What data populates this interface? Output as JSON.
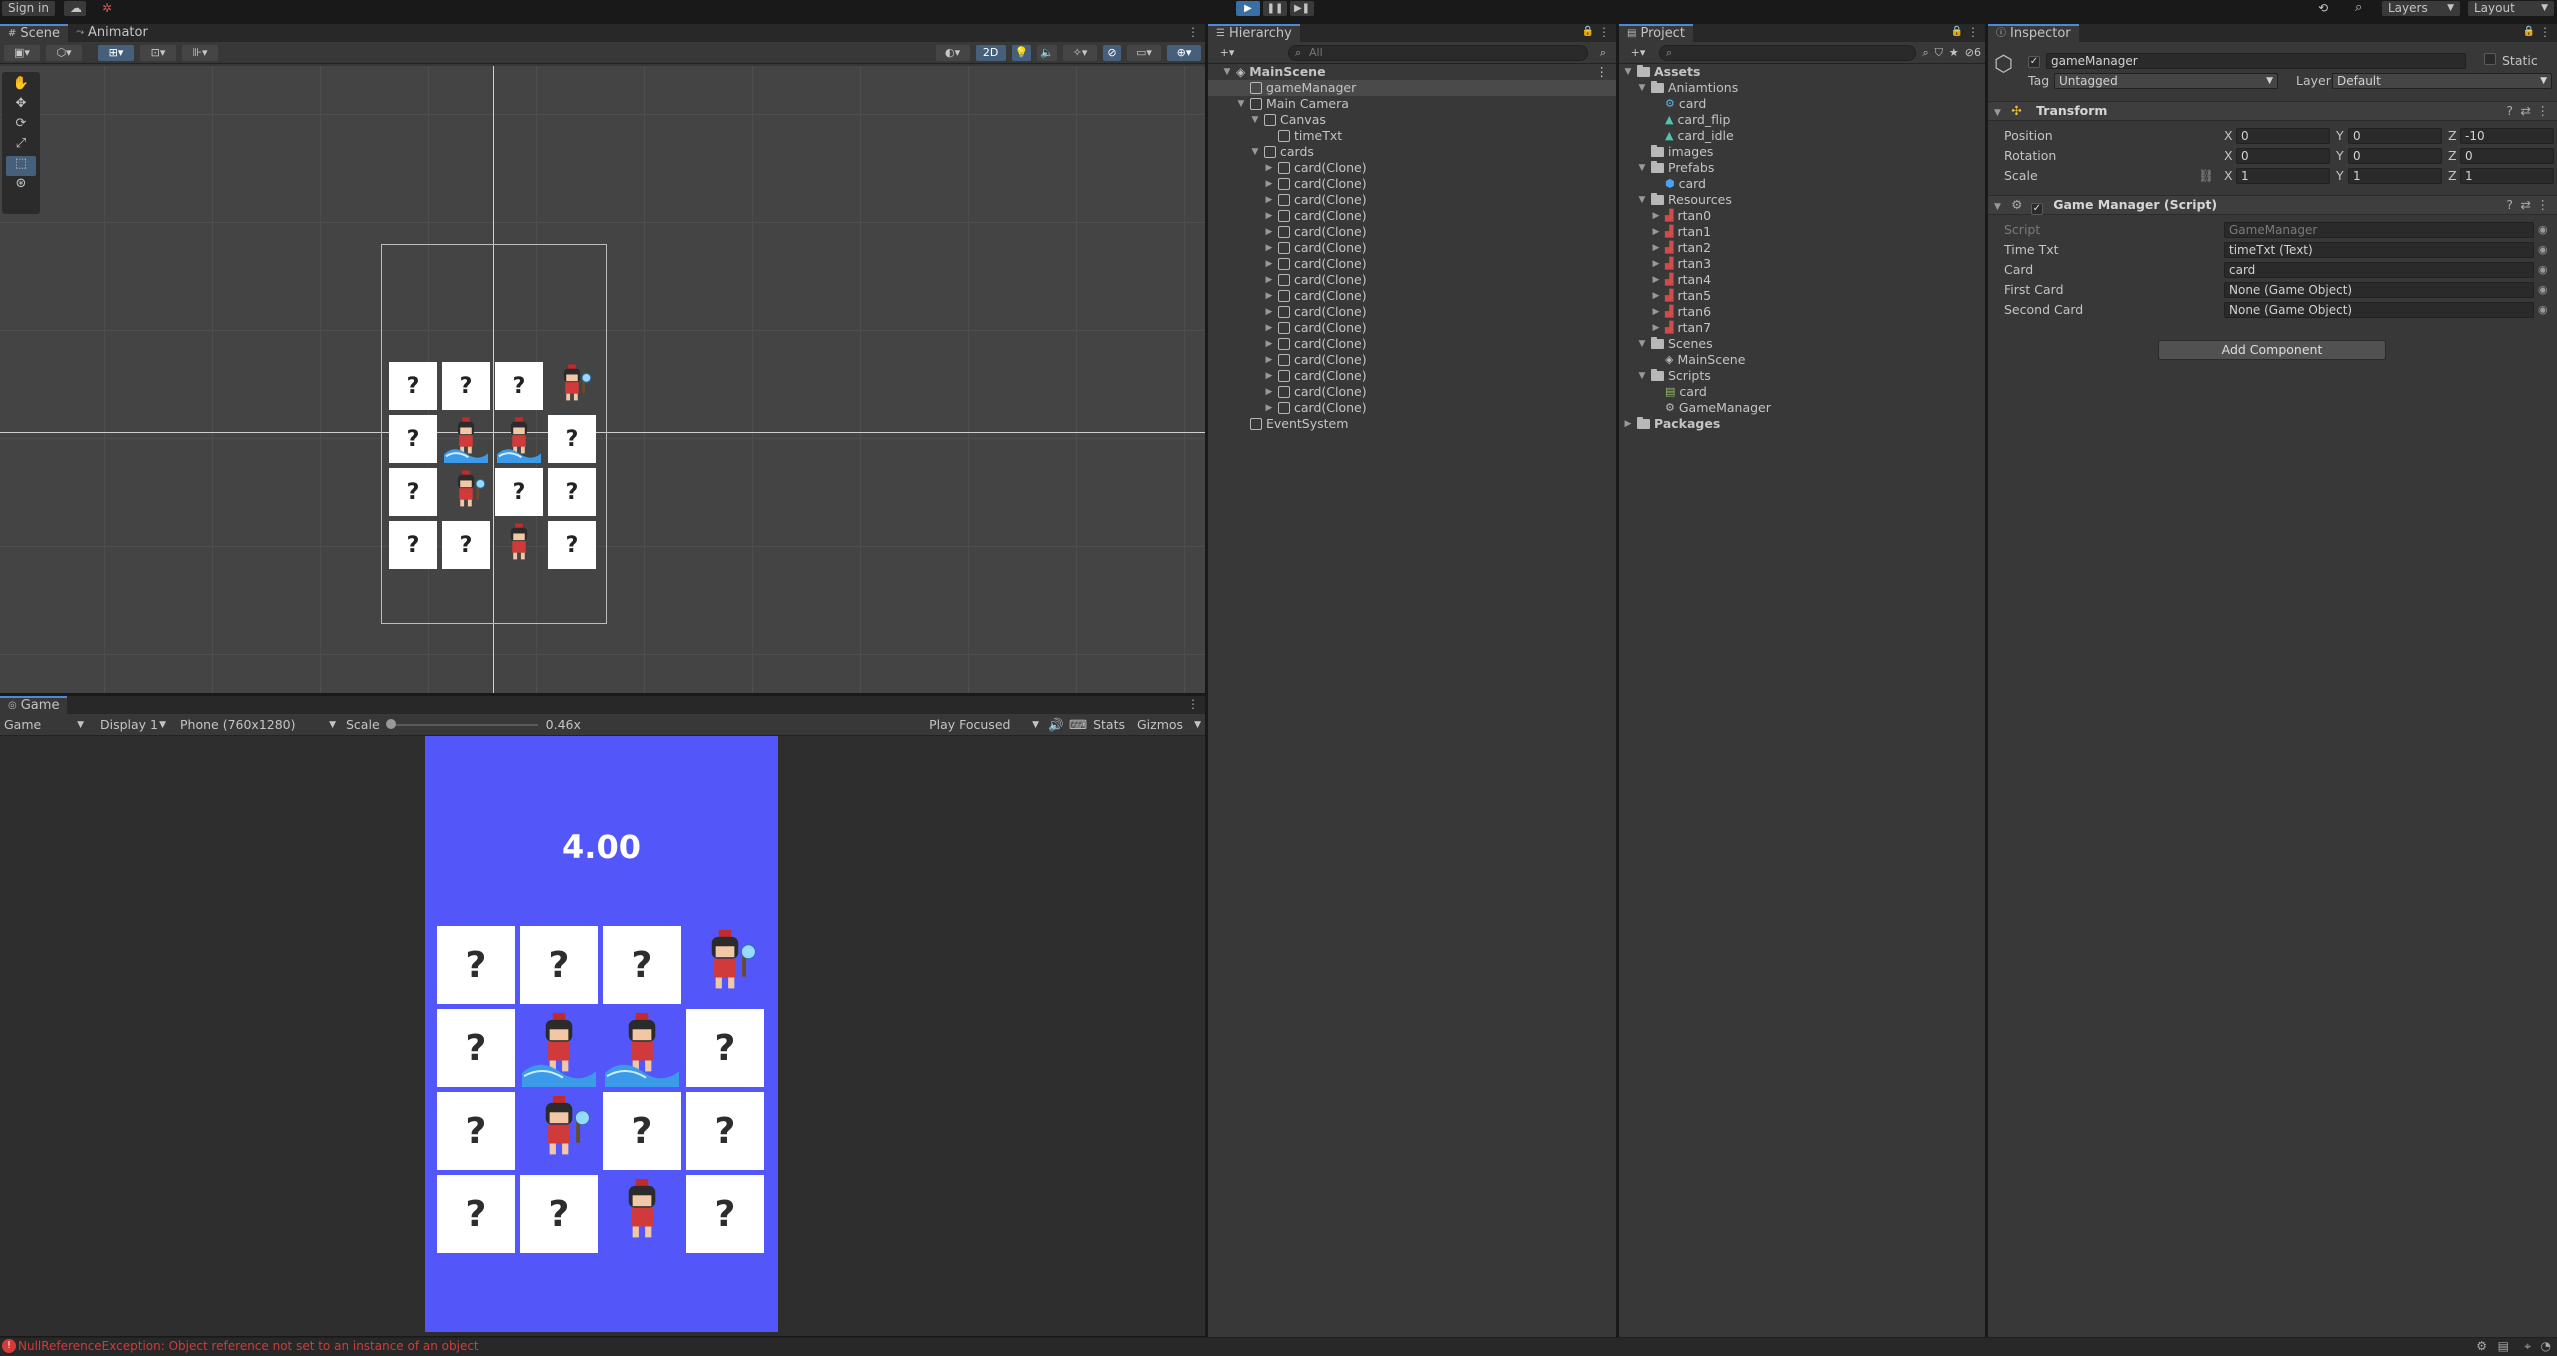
{
  "toolbar": {
    "signin": "Sign in",
    "layers": "Layers",
    "layout": "Layout"
  },
  "scene_panel": {
    "tabs": [
      "Scene",
      "Animator"
    ],
    "btn_2d": "2D"
  },
  "game_panel": {
    "tab": "Game",
    "display_mode": "Game",
    "display": "Display 1",
    "resolution": "Phone (760x1280)",
    "scale_label": "Scale",
    "scale_value": "0.46x",
    "play_focused": "Play Focused",
    "stats": "Stats",
    "gizmos": "Gizmos",
    "timer": "4.00"
  },
  "board": {
    "unknown_symbol": "?",
    "cells": [
      "?",
      "?",
      "?",
      "sprite-axe",
      "?",
      "sprite-wave",
      "sprite-wave",
      "?",
      "?",
      "sprite-axe",
      "?",
      "?",
      "?",
      "?",
      "sprite-stand",
      "?"
    ]
  },
  "hierarchy": {
    "tab": "Hierarchy",
    "search_placeholder": "All",
    "items": [
      {
        "label": "MainScene",
        "depth": 0,
        "expanded": true,
        "bold": true
      },
      {
        "label": "gameManager",
        "depth": 1,
        "selected": true
      },
      {
        "label": "Main Camera",
        "depth": 1,
        "expanded": true
      },
      {
        "label": "Canvas",
        "depth": 2,
        "expanded": true
      },
      {
        "label": "timeTxt",
        "depth": 3
      },
      {
        "label": "cards",
        "depth": 2,
        "expanded": true
      },
      {
        "label": "card(Clone)",
        "depth": 3,
        "collapsed": true
      },
      {
        "label": "card(Clone)",
        "depth": 3,
        "collapsed": true
      },
      {
        "label": "card(Clone)",
        "depth": 3,
        "collapsed": true
      },
      {
        "label": "card(Clone)",
        "depth": 3,
        "collapsed": true
      },
      {
        "label": "card(Clone)",
        "depth": 3,
        "collapsed": true
      },
      {
        "label": "card(Clone)",
        "depth": 3,
        "collapsed": true
      },
      {
        "label": "card(Clone)",
        "depth": 3,
        "collapsed": true
      },
      {
        "label": "card(Clone)",
        "depth": 3,
        "collapsed": true
      },
      {
        "label": "card(Clone)",
        "depth": 3,
        "collapsed": true
      },
      {
        "label": "card(Clone)",
        "depth": 3,
        "collapsed": true
      },
      {
        "label": "card(Clone)",
        "depth": 3,
        "collapsed": true
      },
      {
        "label": "card(Clone)",
        "depth": 3,
        "collapsed": true
      },
      {
        "label": "card(Clone)",
        "depth": 3,
        "collapsed": true
      },
      {
        "label": "card(Clone)",
        "depth": 3,
        "collapsed": true
      },
      {
        "label": "card(Clone)",
        "depth": 3,
        "collapsed": true
      },
      {
        "label": "card(Clone)",
        "depth": 3,
        "collapsed": true
      },
      {
        "label": "EventSystem",
        "depth": 1
      }
    ]
  },
  "project": {
    "tab": "Project",
    "badge": "6",
    "items": [
      {
        "label": "Assets",
        "depth": 0,
        "type": "folder",
        "expanded": true,
        "bold": true
      },
      {
        "label": "Aniamtions",
        "depth": 1,
        "type": "folder",
        "expanded": true
      },
      {
        "label": "card",
        "depth": 2,
        "type": "anim"
      },
      {
        "label": "card_flip",
        "depth": 2,
        "type": "anim-clip"
      },
      {
        "label": "card_idle",
        "depth": 2,
        "type": "anim-clip"
      },
      {
        "label": "images",
        "depth": 1,
        "type": "folder"
      },
      {
        "label": "Prefabs",
        "depth": 1,
        "type": "folder",
        "expanded": true
      },
      {
        "label": "card",
        "depth": 2,
        "type": "prefab"
      },
      {
        "label": "Resources",
        "depth": 1,
        "type": "folder",
        "expanded": true
      },
      {
        "label": "rtan0",
        "depth": 2,
        "type": "sprite",
        "collapsed": true
      },
      {
        "label": "rtan1",
        "depth": 2,
        "type": "sprite",
        "collapsed": true
      },
      {
        "label": "rtan2",
        "depth": 2,
        "type": "sprite",
        "collapsed": true
      },
      {
        "label": "rtan3",
        "depth": 2,
        "type": "sprite",
        "collapsed": true
      },
      {
        "label": "rtan4",
        "depth": 2,
        "type": "sprite",
        "collapsed": true
      },
      {
        "label": "rtan5",
        "depth": 2,
        "type": "sprite",
        "collapsed": true
      },
      {
        "label": "rtan6",
        "depth": 2,
        "type": "sprite",
        "collapsed": true
      },
      {
        "label": "rtan7",
        "depth": 2,
        "type": "sprite",
        "collapsed": true
      },
      {
        "label": "Scenes",
        "depth": 1,
        "type": "folder",
        "expanded": true
      },
      {
        "label": "MainScene",
        "depth": 2,
        "type": "scene"
      },
      {
        "label": "Scripts",
        "depth": 1,
        "type": "folder",
        "expanded": true
      },
      {
        "label": "card",
        "depth": 2,
        "type": "script"
      },
      {
        "label": "GameManager",
        "depth": 2,
        "type": "gm-script"
      },
      {
        "label": "Packages",
        "depth": 0,
        "type": "folder",
        "collapsed": true,
        "bold": true
      }
    ]
  },
  "inspector": {
    "tab": "Inspector",
    "object_name": "gameManager",
    "static_label": "Static",
    "tag_label": "Tag",
    "tag_value": "Untagged",
    "layer_label": "Layer",
    "layer_value": "Default",
    "transform": {
      "title": "Transform",
      "position_label": "Position",
      "rotation_label": "Rotation",
      "scale_label": "Scale",
      "axis_x": "X",
      "axis_y": "Y",
      "axis_z": "Z",
      "position": [
        "0",
        "0",
        "-10"
      ],
      "rotation": [
        "0",
        "0",
        "0"
      ],
      "scale": [
        "1",
        "1",
        "1"
      ]
    },
    "script_component": {
      "title": "Game Manager (Script)",
      "fields": [
        {
          "label": "Script",
          "value": "GameManager",
          "disabled": true
        },
        {
          "label": "Time Txt",
          "value": "timeTxt (Text)"
        },
        {
          "label": "Card",
          "value": "card"
        },
        {
          "label": "First Card",
          "value": "None (Game Object)"
        },
        {
          "label": "Second Card",
          "value": "None (Game Object)"
        }
      ]
    },
    "add_component": "Add Component"
  },
  "status": {
    "message": "NullReferenceException: Object reference not set to an instance of an object"
  },
  "colors": {
    "accent": "#3b6ea5",
    "game_background": "#5357f9",
    "error": "#d13b3b"
  }
}
